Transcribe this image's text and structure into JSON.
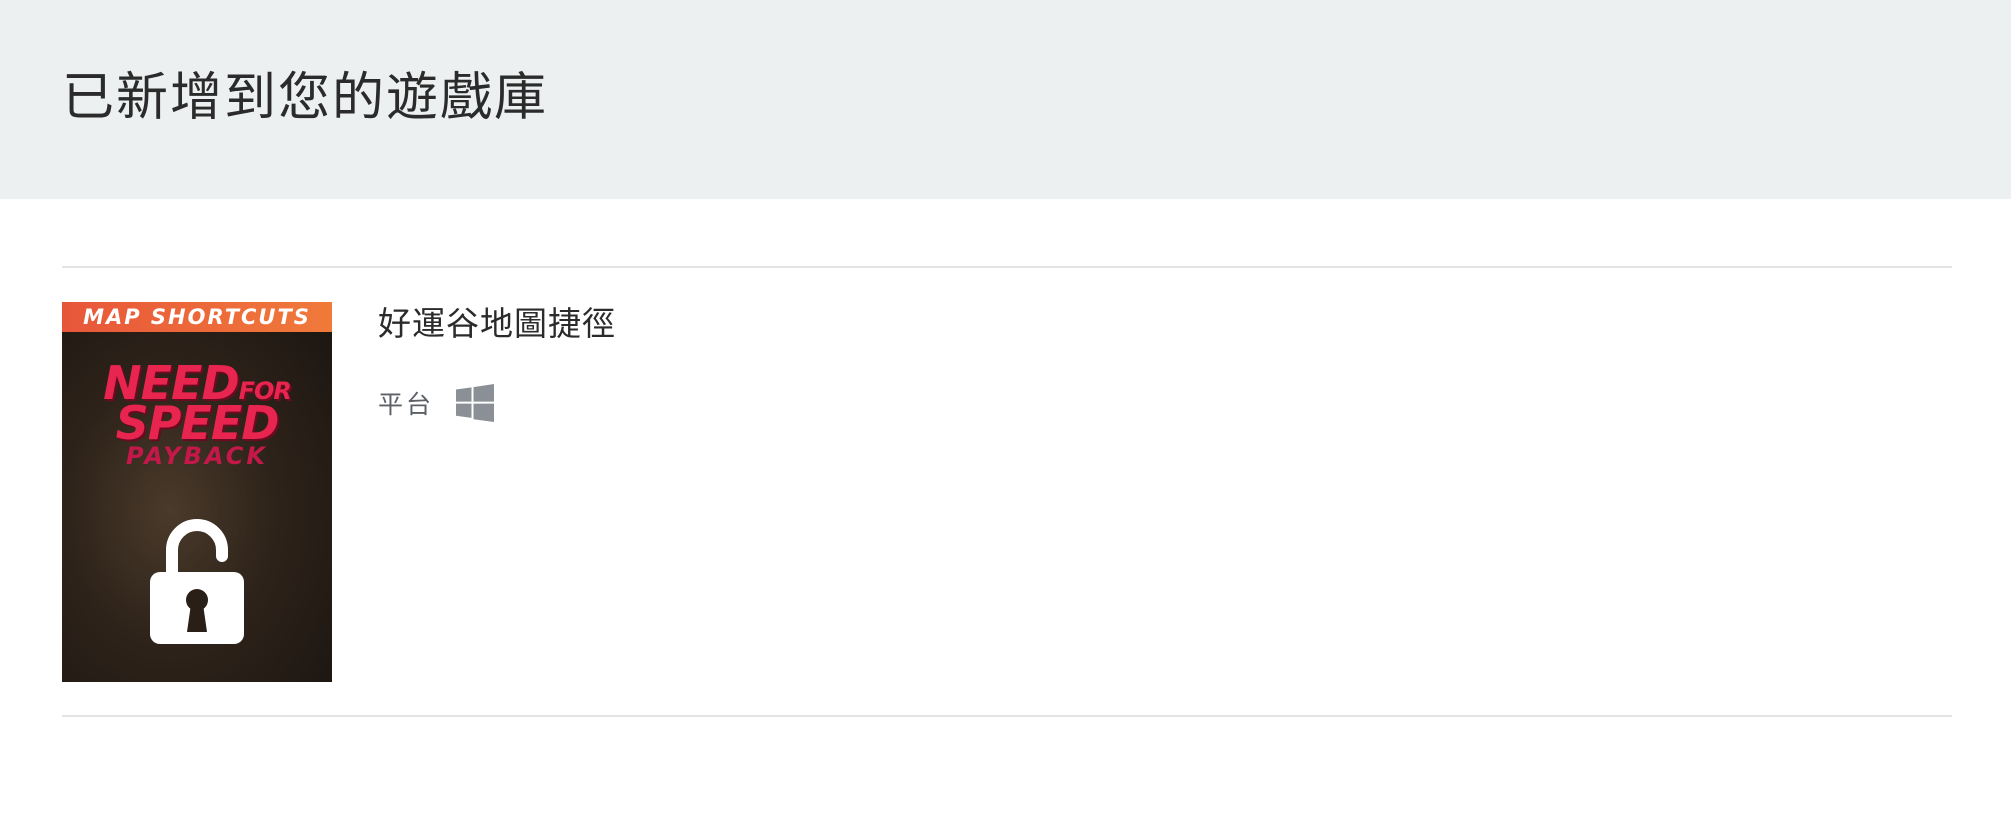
{
  "header": {
    "title": "已新增到您的遊戲庫"
  },
  "item": {
    "title": "好運谷地圖捷徑",
    "platform_label": "平台",
    "platform_icon": "windows-icon",
    "cover": {
      "banner_text": "MAP SHORTCUTS",
      "logo_need": "NEED",
      "logo_for": "FOR",
      "logo_speed": "SPEED",
      "logo_payback": "PAYBACK",
      "lock_icon": "unlocked-padlock-icon"
    }
  },
  "colors": {
    "header_bg": "#edf0f1",
    "banner": "#f07a3a",
    "logo_pink": "#e8254e",
    "platform_icon": "#8b9097"
  }
}
